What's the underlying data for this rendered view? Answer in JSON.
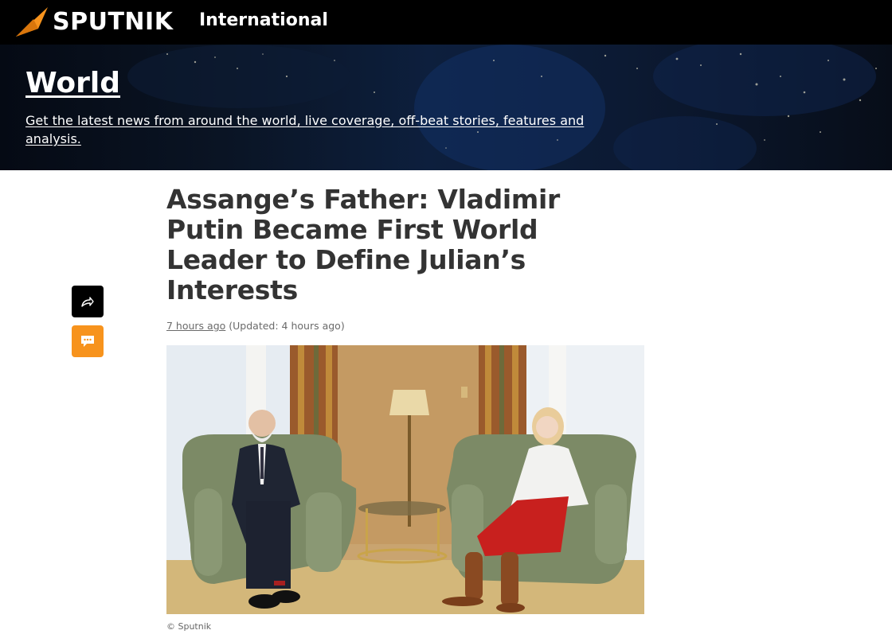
{
  "header": {
    "logo_text": "SPUTNIK",
    "edition": "International",
    "logo_color": "#f7931d"
  },
  "section": {
    "title": "World",
    "description": "Get the latest news from around the world, live coverage, off-beat stories, features and analysis."
  },
  "article": {
    "headline": "Assange’s Father: Vladimir Putin Became First World Leader to Define Julian’s Interests",
    "time_ago": "7 hours ago",
    "updated": "(Updated: 4 hours ago)",
    "photo_caption": "© Sputnik"
  },
  "actions": {
    "share_icon": "share-arrow-icon",
    "comment_icon": "comment-bubble-icon",
    "comment_color": "#f7931d"
  }
}
